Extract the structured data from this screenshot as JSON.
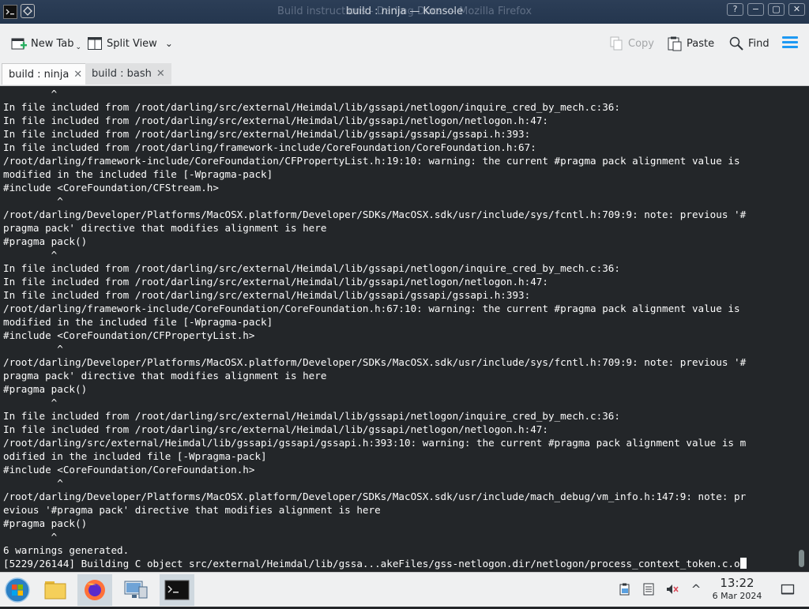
{
  "window": {
    "title": "build : ninja — Konsole",
    "background_title": "Build instructions - Darling Docs — Mozilla Firefox",
    "btn_help": "?",
    "btn_minimize": "−",
    "btn_maximize": "▢",
    "btn_close": "✕"
  },
  "toolbar": {
    "new_tab": "New Tab",
    "split_view": "Split View",
    "copy": "Copy",
    "paste": "Paste",
    "find": "Find"
  },
  "tabs": [
    {
      "label": "build : ninja",
      "active": true,
      "close": "✕"
    },
    {
      "label": "build : bash",
      "active": false,
      "close": "✕"
    }
  ],
  "terminal": {
    "lines": [
      "        ^",
      "In file included from /root/darling/src/external/Heimdal/lib/gssapi/netlogon/inquire_cred_by_mech.c:36:",
      "In file included from /root/darling/src/external/Heimdal/lib/gssapi/netlogon/netlogon.h:47:",
      "In file included from /root/darling/src/external/Heimdal/lib/gssapi/gssapi/gssapi.h:393:",
      "In file included from /root/darling/framework-include/CoreFoundation/CoreFoundation.h:67:",
      "/root/darling/framework-include/CoreFoundation/CFPropertyList.h:19:10: warning: the current #pragma pack alignment value is",
      "modified in the included file [-Wpragma-pack]",
      "#include <CoreFoundation/CFStream.h>",
      "         ^",
      "/root/darling/Developer/Platforms/MacOSX.platform/Developer/SDKs/MacOSX.sdk/usr/include/sys/fcntl.h:709:9: note: previous '#",
      "pragma pack' directive that modifies alignment is here",
      "#pragma pack()",
      "        ^",
      "In file included from /root/darling/src/external/Heimdal/lib/gssapi/netlogon/inquire_cred_by_mech.c:36:",
      "In file included from /root/darling/src/external/Heimdal/lib/gssapi/netlogon/netlogon.h:47:",
      "In file included from /root/darling/src/external/Heimdal/lib/gssapi/gssapi/gssapi.h:393:",
      "/root/darling/framework-include/CoreFoundation/CoreFoundation.h:67:10: warning: the current #pragma pack alignment value is",
      "modified in the included file [-Wpragma-pack]",
      "#include <CoreFoundation/CFPropertyList.h>",
      "         ^",
      "/root/darling/Developer/Platforms/MacOSX.platform/Developer/SDKs/MacOSX.sdk/usr/include/sys/fcntl.h:709:9: note: previous '#",
      "pragma pack' directive that modifies alignment is here",
      "#pragma pack()",
      "        ^",
      "In file included from /root/darling/src/external/Heimdal/lib/gssapi/netlogon/inquire_cred_by_mech.c:36:",
      "In file included from /root/darling/src/external/Heimdal/lib/gssapi/netlogon/netlogon.h:47:",
      "/root/darling/src/external/Heimdal/lib/gssapi/gssapi/gssapi.h:393:10: warning: the current #pragma pack alignment value is m",
      "odified in the included file [-Wpragma-pack]",
      "#include <CoreFoundation/CoreFoundation.h>",
      "         ^",
      "/root/darling/Developer/Platforms/MacOSX.platform/Developer/SDKs/MacOSX.sdk/usr/include/mach_debug/vm_info.h:147:9: note: pr",
      "evious '#pragma pack' directive that modifies alignment is here",
      "#pragma pack()",
      "        ^",
      "6 warnings generated.",
      "[5229/26144] Building C object src/external/Heimdal/lib/gssa...akeFiles/gss-netlogon.dir/netlogon/process_context_token.c.o"
    ]
  },
  "taskbar": {
    "time": "13:22",
    "date": "6 Mar 2024",
    "tray_up_arrow": "^"
  },
  "colors": {
    "terminal_bg": "#232629",
    "terminal_fg": "#fcfcfc",
    "accent": "#1d99f3",
    "toolbar_bg": "#eff0f1"
  }
}
